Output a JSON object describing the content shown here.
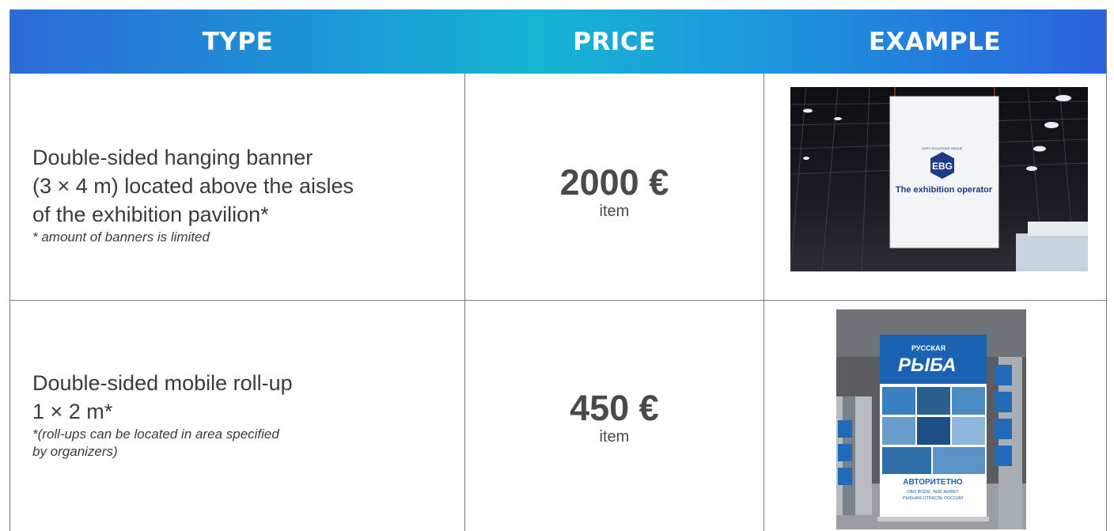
{
  "header": {
    "col_type": "TYPE",
    "col_price": "PRICE",
    "col_example": "EXAMPLE",
    "gradient_colors": [
      "#2c6ad6",
      "#16b4d3",
      "#2a63dd"
    ]
  },
  "rows": [
    {
      "type_main": "Double-sided hanging banner\n(3 × 4 m) located above the aisles\nof the exhibition pavilion*",
      "type_note": "* amount of banners is limited",
      "price": "2000 €",
      "unit": "item",
      "photo": {
        "description_icon": "hanging-banner-photo",
        "logo_text": "EBG",
        "logo_small": "EXPO SOLUTIONS GROUP",
        "caption": "The exhibition operator"
      }
    },
    {
      "type_main": "Double-sided mobile roll-up\n1 × 2 m*",
      "type_note": "*(roll-ups can be located in area specified\nby organizers)",
      "price": "450 €",
      "unit": "item",
      "photo": {
        "description_icon": "rollup-photo",
        "title_small": "РУССКАЯ",
        "title_big": "РЫБА",
        "slogan": "АВТОРИТЕТНО",
        "sub1": "ОБО ВСЕМ, ЧЕМ ЖИВЕТ",
        "sub2": "РЫБНАЯ ОТРАСЛЬ РОССИИ"
      }
    }
  ]
}
